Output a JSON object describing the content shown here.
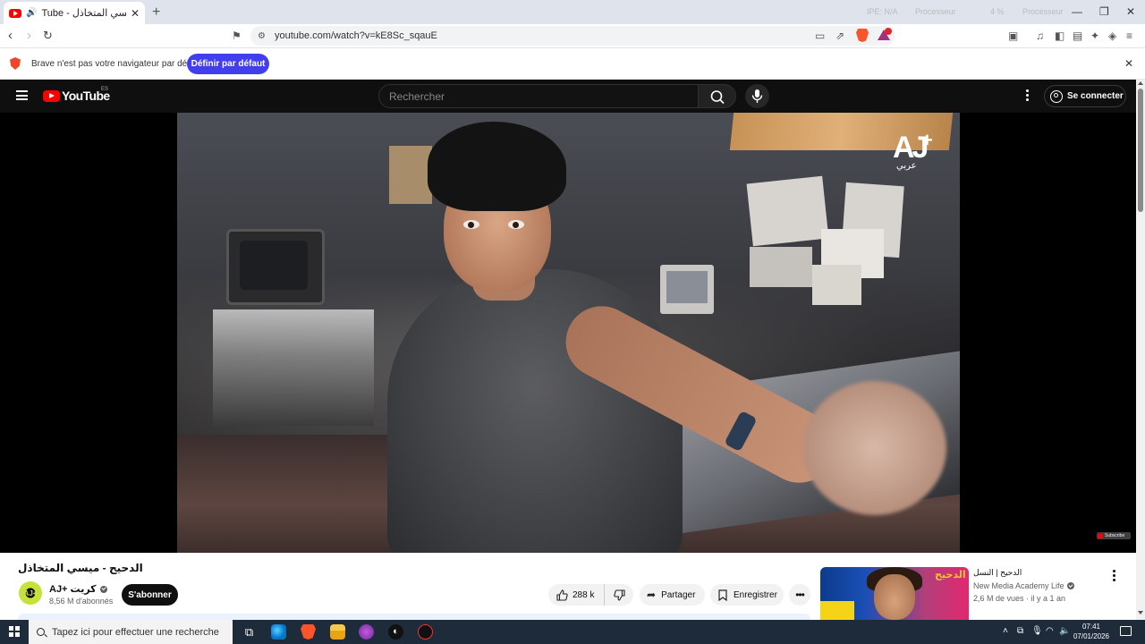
{
  "browser": {
    "tab": {
      "title": "Tube - الدحيح - ميسي المتخاذل"
    },
    "address": {
      "url": "youtube.com/watch?v=kE8Sc_sqauE"
    },
    "system_monitor": [
      "IPE: N/A",
      "Processeur",
      "4 %",
      "Processeur"
    ],
    "infobar": {
      "message": "Brave n'est pas votre navigateur par défaut",
      "button": "Définir par défaut"
    }
  },
  "youtube": {
    "logo": {
      "text": "YouTube",
      "country": "ES"
    },
    "search": {
      "placeholder": "Rechercher"
    },
    "signin_label": "Se connecter",
    "video": {
      "title": "الدحيح - ميسي المتخاذل",
      "channel": {
        "name": "AJ+ كريت",
        "subscribers": "8,56 M d'abonnés",
        "avatar_text": "AJ+"
      },
      "subscribe_label": "S'abonner",
      "likes": "288 k",
      "share_label": "Partager",
      "save_label": "Enregistrer",
      "overlay": {
        "brand": "AJ",
        "brand_sub": "عربي",
        "watermark": "Subscribe"
      }
    },
    "recommendation": {
      "title": "الدحيح | النسل",
      "thumb_label": "الدحيح",
      "channel": "New Media Academy Life",
      "meta": "2,6 M de vues · il y a 1 an"
    }
  },
  "taskbar": {
    "search_placeholder": "Tapez ici pour effectuer une recherche",
    "time": "07:41",
    "date": "07/01/2026"
  },
  "colors": {
    "brave_accent": "#423eee",
    "youtube_red": "#ff0000",
    "youtube_dark": "#0f0f0f",
    "taskbar": "#1d2b3a"
  }
}
